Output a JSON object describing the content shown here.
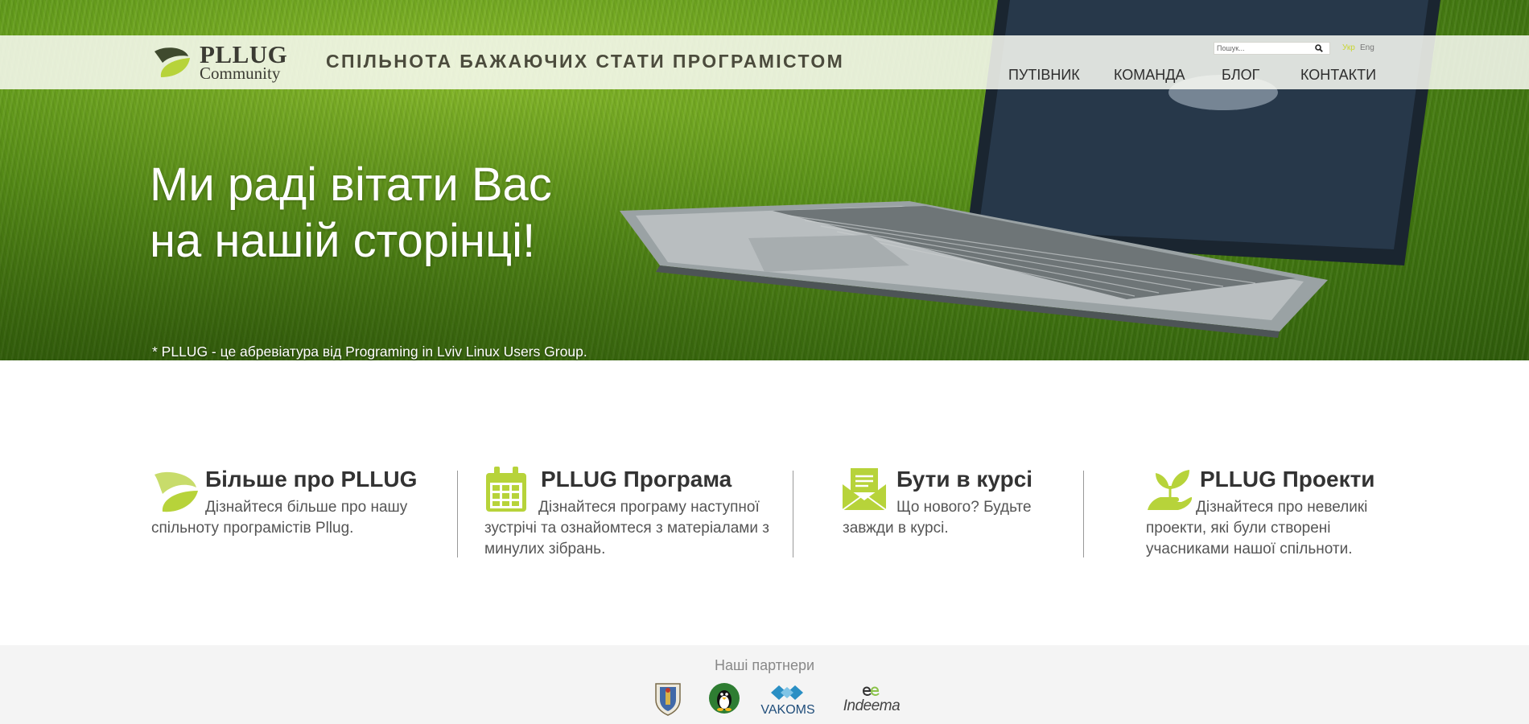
{
  "header": {
    "logo_title": "PLLUG",
    "logo_subtitle": "Community",
    "tagline": "СПІЛЬНОТА БАЖАЮЧИХ СТАТИ ПРОГРАМІСТОМ",
    "search_placeholder": "Пошук...",
    "lang_ua": "Укр",
    "lang_en": "Eng",
    "nav": [
      "ПУТІВНИК",
      "КОМАНДА",
      "БЛОГ",
      "КОНТАКТИ"
    ]
  },
  "hero": {
    "title_line1": "Ми раді вітати Вас",
    "title_line2": "на нашій сторінці!",
    "note": "* PLLUG - це абревіатура від Programing in Lviv Linux Users Group."
  },
  "features": [
    {
      "icon": "leaf-icon",
      "title": "Більше про PLLUG",
      "text": "Дізнайтеся більше про нашу спільноту програмістів Pllug."
    },
    {
      "icon": "calendar-icon",
      "title": "PLLUG Програма",
      "text": "Дізнайтеся програму наступної зустрічі та ознайомтеся з матеріалами з минулих зібрань."
    },
    {
      "icon": "envelope-icon",
      "title": "Бути в курсі",
      "text": "Що нового? Будьте завжди в курсі."
    },
    {
      "icon": "hand-plant-icon",
      "title": "PLLUG Проекти",
      "text": "Дізнайтеся про невеликі проекти, які були створені учасниками нашої спільноти."
    }
  ],
  "footer": {
    "title": "Наші партнери",
    "partners": [
      {
        "icon": "university-crest-icon"
      },
      {
        "icon": "tux-penguin-icon"
      },
      {
        "icon": "vakoms-logo",
        "label": "VAKOMS"
      },
      {
        "icon": "indeema-logo",
        "label": "Indeema"
      }
    ]
  },
  "colors": {
    "accent_green": "#b7d33a",
    "text_dark": "#333333",
    "footer_bg": "#f4f4f4"
  }
}
